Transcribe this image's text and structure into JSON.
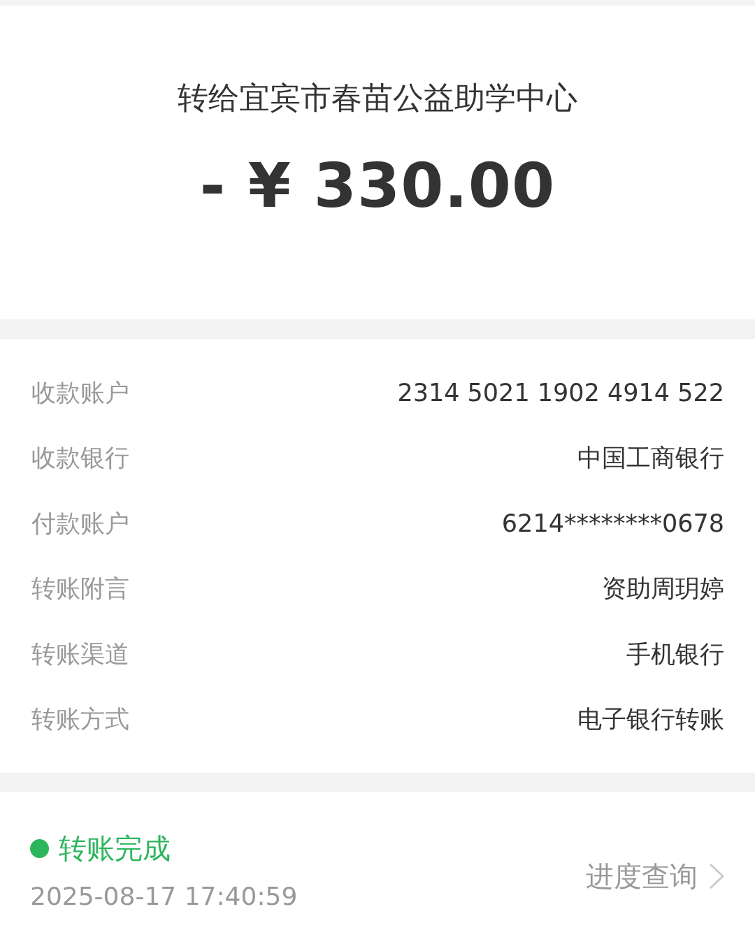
{
  "header": {
    "title": "转给宜宾市春苗公益助学中心",
    "amount": "- ¥ 330.00"
  },
  "details": [
    {
      "label": "收款账户",
      "value": "2314 5021 1902 4914 522"
    },
    {
      "label": "收款银行",
      "value": "中国工商银行"
    },
    {
      "label": "付款账户",
      "value": "6214********0678"
    },
    {
      "label": "转账附言",
      "value": "资助周玥婷"
    },
    {
      "label": "转账渠道",
      "value": "手机银行"
    },
    {
      "label": "转账方式",
      "value": "电子银行转账"
    }
  ],
  "status": {
    "kind": "completed",
    "text": "转账完成",
    "time": "2025-08-17 17:40:59",
    "link": "进度查询"
  }
}
